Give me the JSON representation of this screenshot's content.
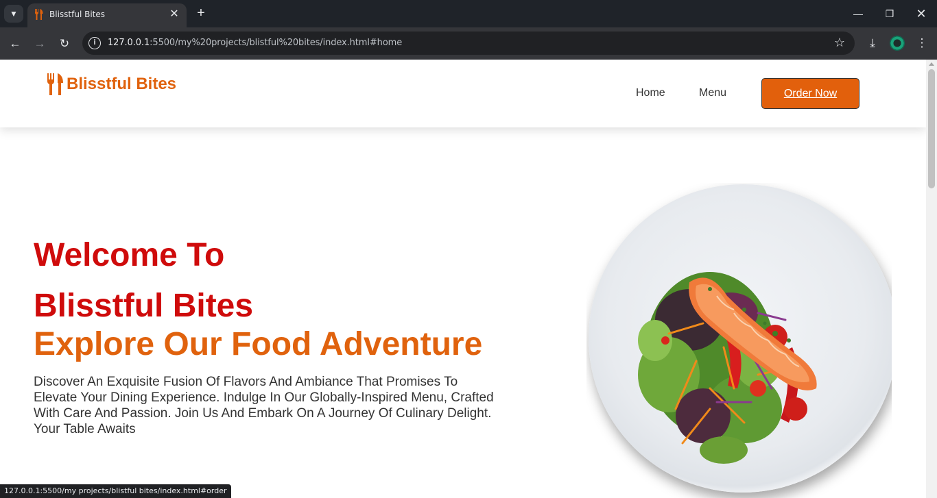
{
  "browser": {
    "tab_title": "Blisstful Bites",
    "url_host": "127.0.0.1",
    "url_rest": ":5500/my%20projects/blistful%20bites/index.html#home",
    "status_url": "127.0.0.1:5500/my projects/blistful bites/index.html#order"
  },
  "site": {
    "brand": "Blisstful Bites",
    "nav": {
      "home": "Home",
      "menu": "Menu",
      "order": "Order Now"
    },
    "hero": {
      "welcome": "Welcome To",
      "brand": "Blisstful Bites",
      "tagline": "Explore Our Food Adventure",
      "description": "Discover An Exquisite Fusion Of Flavors And Ambiance That Promises To Elevate Your Dining Experience. Indulge In Our Globally-Inspired Menu, Crafted With Care And Passion. Join Us And Embark On A Journey Of Culinary Delight. Your Table Awaits"
    }
  },
  "colors": {
    "brand_orange": "#e0620d",
    "heading_red": "#cf0b0b",
    "button_orange": "#e2600c"
  },
  "icons": [
    "tab-search-icon",
    "fork-knife-icon",
    "close-icon",
    "plus-icon",
    "minimize-icon",
    "restore-icon",
    "back-icon",
    "forward-icon",
    "reload-icon",
    "info-icon",
    "star-icon",
    "download-icon",
    "extension-icon",
    "kebab-menu-icon"
  ]
}
